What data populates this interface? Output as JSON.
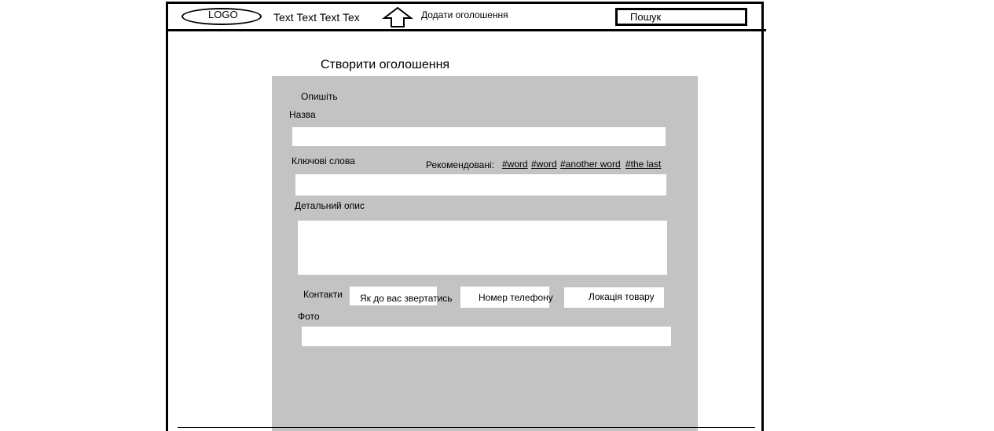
{
  "header": {
    "logo_text": "LOGO",
    "nav_text": "Text Text Text Text",
    "add_ad_label": "Додати оголошення",
    "search_placeholder": "Пошук"
  },
  "form": {
    "title": "Створити оголошення",
    "section_label": "Опишіть",
    "name_label": "Назва",
    "keywords_label": "Ключові слова",
    "recommended_label": "Рекомендовані:",
    "recommended_tags": [
      "#word",
      "#word",
      "#another word",
      "#the last"
    ],
    "description_label": "Детальний опис",
    "contacts_label": "Контакти",
    "contact_name_placeholder": "Як до вас звертатись",
    "contact_phone_placeholder": "Номер телефону",
    "contact_location_placeholder": "Локація товару",
    "photo_label": "Фото"
  },
  "colors": {
    "panel_background": "#c3c3c3",
    "border": "#000000"
  }
}
